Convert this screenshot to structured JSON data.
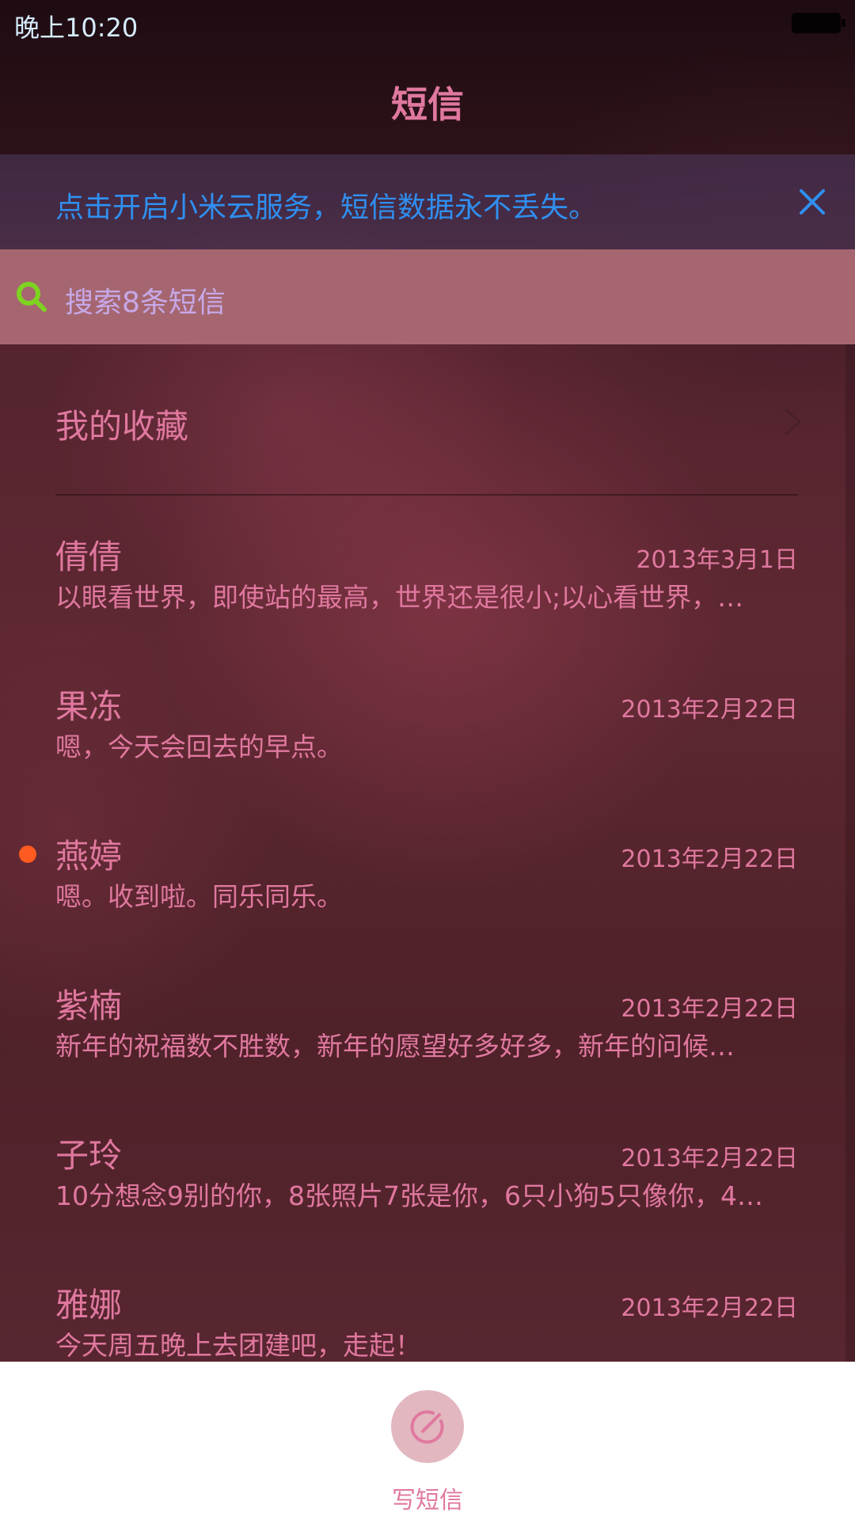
{
  "status_bar": {
    "time": "晚上10:20",
    "battery_icon": "battery-icon"
  },
  "header": {
    "title": "短信"
  },
  "cloud_banner": {
    "text": "点击开启小米云服务，短信数据永不丢失。",
    "close_icon": "close-icon",
    "text_color": "#2f8ff0"
  },
  "search": {
    "placeholder": "搜索8条短信",
    "icon": "search-icon",
    "icon_color": "#7ed321"
  },
  "favorites": {
    "label": "我的收藏",
    "icon": "chevron-right-icon"
  },
  "threads": [
    {
      "name": "倩倩",
      "date": "2013年3月1日",
      "preview": "以眼看世界，即使站的最高，世界还是很小;以心看世界，…",
      "unread": false
    },
    {
      "name": "果冻",
      "date": "2013年2月22日",
      "preview": "嗯，今天会回去的早点。",
      "unread": false
    },
    {
      "name": "燕婷",
      "date": "2013年2月22日",
      "preview": "嗯。收到啦。同乐同乐。",
      "unread": true
    },
    {
      "name": "紫楠",
      "date": "2013年2月22日",
      "preview": "新年的祝福数不胜数，新年的愿望好多好多，新年的问候…",
      "unread": false
    },
    {
      "name": "子玲",
      "date": "2013年2月22日",
      "preview": "10分想念9别的你，8张照片7张是你，6只小狗5只像你，4…",
      "unread": false
    },
    {
      "name": "雅娜",
      "date": "2013年2月22日",
      "preview": "今天周五晚上去团建吧，走起！",
      "unread": false
    }
  ],
  "compose": {
    "label": "写短信",
    "icon": "compose-icon"
  },
  "colors": {
    "accent": "#e0789f",
    "unread_dot": "#ff5a1f",
    "search_bar_bg": "#a56670",
    "status_time": "#d6ecff"
  }
}
